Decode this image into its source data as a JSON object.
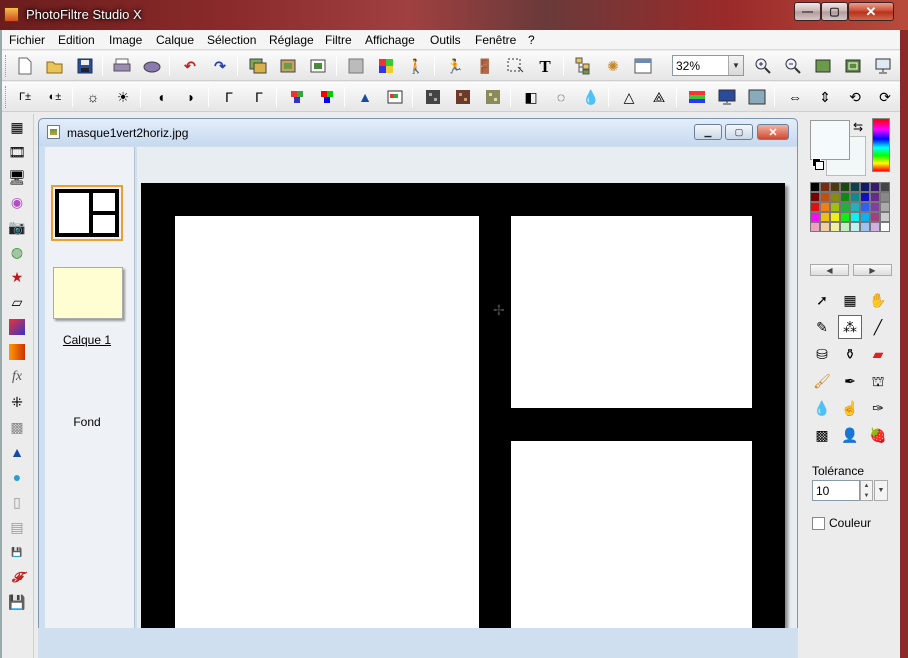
{
  "window": {
    "title": "PhotoFiltre Studio X"
  },
  "menu": [
    "Fichier",
    "Edition",
    "Image",
    "Calque",
    "Sélection",
    "Réglage",
    "Filtre",
    "Affichage",
    "Outils",
    "Fenêtre",
    "?"
  ],
  "toolbar": {
    "zoom": "32%"
  },
  "document": {
    "title": "masque1vert2horiz.jpg",
    "layers": [
      {
        "label": "Calque 1"
      },
      {
        "label": "Fond"
      }
    ]
  },
  "tools": {
    "tolerance_label": "Tolérance",
    "tolerance_value": "10",
    "couleur_label": "Couleur"
  },
  "colors": {
    "accent_selection": "#e8a030",
    "fond_swatch": "#fefed2"
  }
}
